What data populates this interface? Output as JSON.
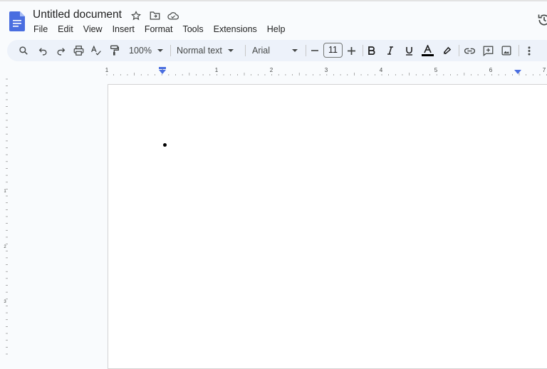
{
  "document": {
    "title": "Untitled document"
  },
  "menu": [
    "File",
    "Edit",
    "View",
    "Insert",
    "Format",
    "Tools",
    "Extensions",
    "Help"
  ],
  "toolbar": {
    "zoom": "100%",
    "style": "Normal text",
    "font": "Arial",
    "font_size": "11"
  },
  "ruler": {
    "labels": [
      "1",
      "1",
      "1",
      "2",
      "3",
      "4",
      "5",
      "6",
      "7"
    ]
  },
  "colors": {
    "accent": "#4a6ee0",
    "toolbar_bg": "#edf2fa",
    "page_bg": "#f9fbfd"
  }
}
